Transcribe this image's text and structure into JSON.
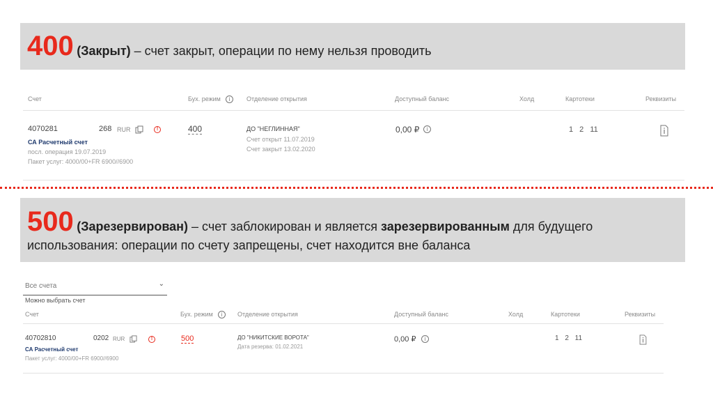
{
  "section1": {
    "code": "400",
    "status_bold": "(Закрыт)",
    "description": " – счет закрыт, операции по нему нельзя проводить"
  },
  "section2": {
    "code": "500",
    "status_bold": "(Зарезервирован)",
    "desc_part1": " – счет заблокирован и является ",
    "desc_bold": "зарезервированным",
    "desc_part2": " для будущего",
    "desc_line2": "использования: операции по счету запрещены, счет находится вне баланса"
  },
  "table1": {
    "headers": {
      "account": "Счет",
      "mode": "Бух. режим",
      "branch": "Отделение открытия",
      "balance": "Доступный баланс",
      "hold": "Холд",
      "cards": "Картотеки",
      "details": "Реквизиты"
    },
    "row": {
      "account_number": "4070281",
      "account_suffix": "268",
      "currency": "RUR",
      "account_name": "СА Расчетный счет",
      "last_operation": "посл. операция 19.07.2019",
      "package": "Пакет услуг: 4000/00+FR 6900//6900",
      "mode_value": "400",
      "branch_name": "ДО \"НЕГЛИННАЯ\"",
      "opened": "Счет открыт 11.07.2019",
      "closed": "Счет закрыт 13.02.2020",
      "balance": "0,00 ₽",
      "cards": "1  2  11"
    }
  },
  "table2": {
    "filter": {
      "selected": "Все счета",
      "hint": "Можно выбрать счет"
    },
    "headers": {
      "account": "Счет",
      "mode": "Бух. режим",
      "branch": "Отделение открытия",
      "balance": "Доступный баланс",
      "hold": "Холд",
      "cards": "Картотеки",
      "details": "Реквизиты"
    },
    "row": {
      "account_number": "40702810",
      "account_suffix": "0202",
      "currency": "RUR",
      "account_name": "СА Расчетный счет",
      "package": "Пакет услуг: 4000/00+FR 6900//6900",
      "mode_value": "500",
      "branch_name": "ДО \"НИКИТСКИЕ ВОРОТА\"",
      "reserve_date": "Дата резерва: 01.02.2021",
      "balance": "0,00 ₽",
      "cards": "1  2  11"
    }
  },
  "colors": {
    "accent": "#e8291c",
    "banner": "#d9d9d9",
    "link": "#1f3a6e"
  },
  "icons": [
    "copy-icon",
    "error-icon",
    "info-icon",
    "document-icon",
    "chevron-down-icon"
  ]
}
